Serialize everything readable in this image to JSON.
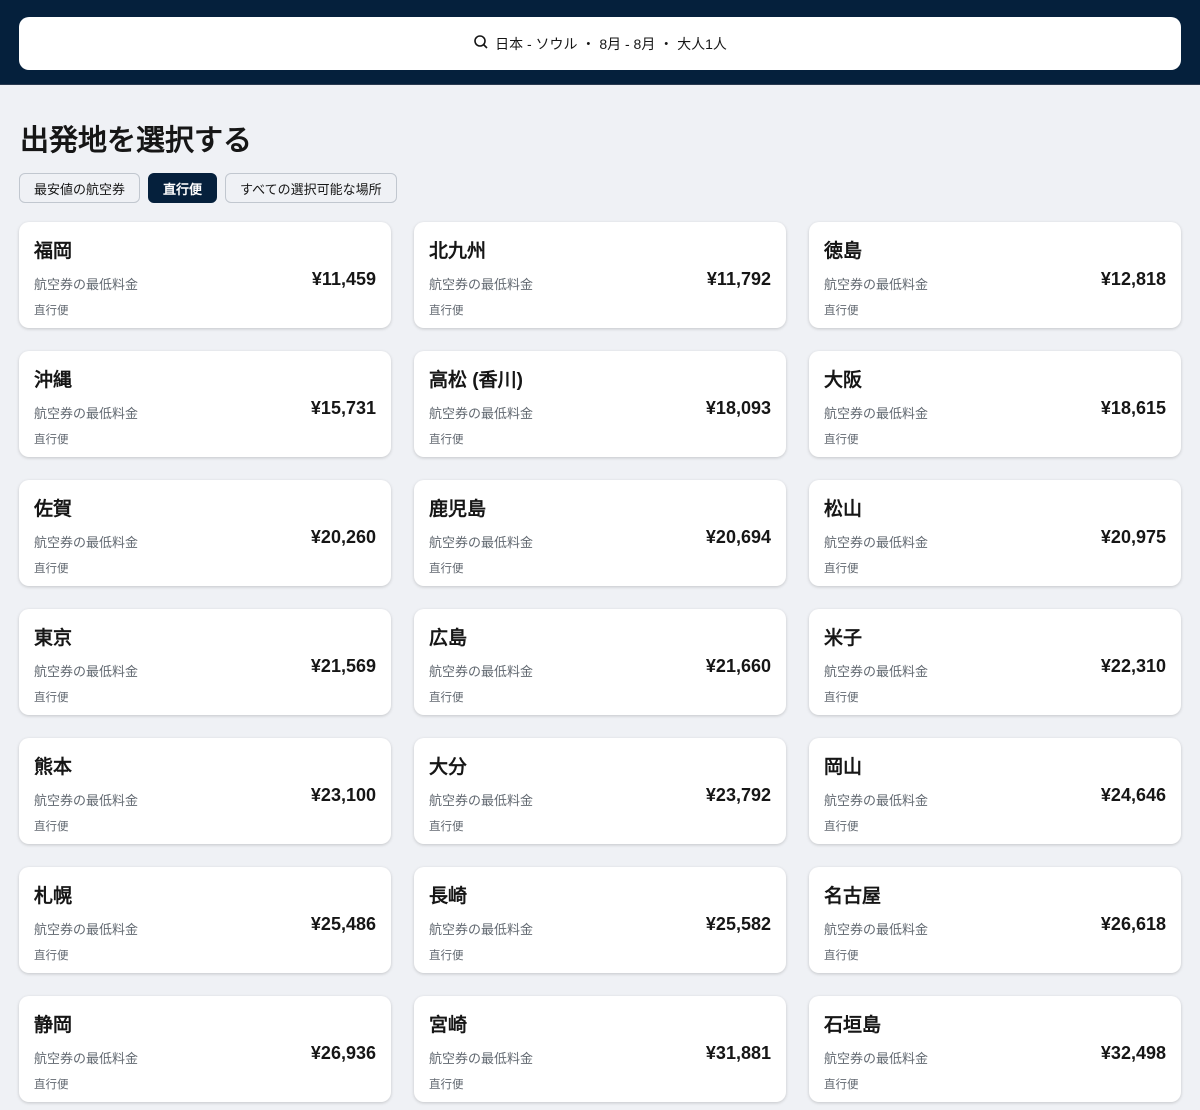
{
  "header": {
    "search_summary": "日本 - ソウル ・ 8月 - 8月 ・ 大人1人"
  },
  "page_title": "出発地を選択する",
  "filters": [
    {
      "label": "最安値の航空券",
      "active": false
    },
    {
      "label": "直行便",
      "active": true
    },
    {
      "label": "すべての選択可能な場所",
      "active": false
    }
  ],
  "price_label": "航空券の最低料金",
  "stops_label": "直行便",
  "destinations": [
    {
      "city": "福岡",
      "price": "¥11,459"
    },
    {
      "city": "北九州",
      "price": "¥11,792"
    },
    {
      "city": "徳島",
      "price": "¥12,818"
    },
    {
      "city": "沖縄",
      "price": "¥15,731"
    },
    {
      "city": "高松 (香川)",
      "price": "¥18,093"
    },
    {
      "city": "大阪",
      "price": "¥18,615"
    },
    {
      "city": "佐賀",
      "price": "¥20,260"
    },
    {
      "city": "鹿児島",
      "price": "¥20,694"
    },
    {
      "city": "松山",
      "price": "¥20,975"
    },
    {
      "city": "東京",
      "price": "¥21,569"
    },
    {
      "city": "広島",
      "price": "¥21,660"
    },
    {
      "city": "米子",
      "price": "¥22,310"
    },
    {
      "city": "熊本",
      "price": "¥23,100"
    },
    {
      "city": "大分",
      "price": "¥23,792"
    },
    {
      "city": "岡山",
      "price": "¥24,646"
    },
    {
      "city": "札幌",
      "price": "¥25,486"
    },
    {
      "city": "長崎",
      "price": "¥25,582"
    },
    {
      "city": "名古屋",
      "price": "¥26,618"
    },
    {
      "city": "静岡",
      "price": "¥26,936"
    },
    {
      "city": "宮崎",
      "price": "¥31,881"
    },
    {
      "city": "石垣島",
      "price": "¥32,498"
    }
  ]
}
